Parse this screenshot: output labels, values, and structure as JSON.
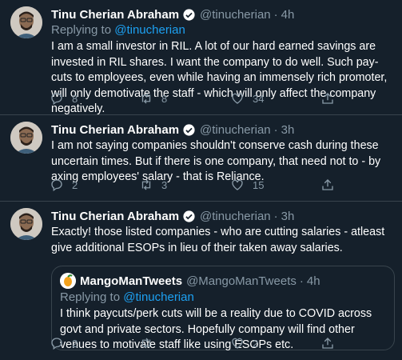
{
  "tweets": [
    {
      "name": "Tinu Cherian Abraham",
      "handle": "@tinucherian",
      "time": "4h",
      "reply_prefix": "Replying to ",
      "reply_to": "@tinucherian",
      "text": "I am a small investor in RIL. A lot of our hard earned savings are invested in RIL shares. I want the company to do well. Such pay-cuts to employees, even while having an immensely rich promoter, will only demotivate the staff - which will only affect the company negatively.",
      "replies": "8",
      "retweets": "8",
      "likes": "34"
    },
    {
      "name": "Tinu Cherian Abraham",
      "handle": "@tinucherian",
      "time": "3h",
      "text": "I am not saying companies shouldn't conserve cash during these uncertain times. But if there is one company, that need not to - by axing employees' salary - that is Reliance.",
      "replies": "2",
      "retweets": "3",
      "likes": "15"
    },
    {
      "name": "Tinu Cherian Abraham",
      "handle": "@tinucherian",
      "time": "3h",
      "text": "Exactly!  those listed companies - who are cutting salaries - atleast give additional ESOPs in lieu of their taken away salaries.",
      "replies": "2",
      "retweets": "",
      "likes": "2",
      "quote": {
        "name": "MangoManTweets",
        "handle": "@MangoManTweets",
        "time": "4h",
        "reply_prefix": "Replying to ",
        "reply_to": "@tinucherian",
        "text": "I think paycuts/perk cuts will be a reality due to COVID across govt and private sectors. Hopefully company will find other venues to motivate staff like using ESOPs etc."
      }
    }
  ],
  "separator": "·",
  "icons": [
    "reply-icon",
    "retweet-icon",
    "like-icon",
    "share-icon",
    "verified-icon"
  ],
  "colors": {
    "background": "#15202b",
    "secondary": "#8899a6",
    "accent": "#1da1f2",
    "border": "#38444d"
  }
}
